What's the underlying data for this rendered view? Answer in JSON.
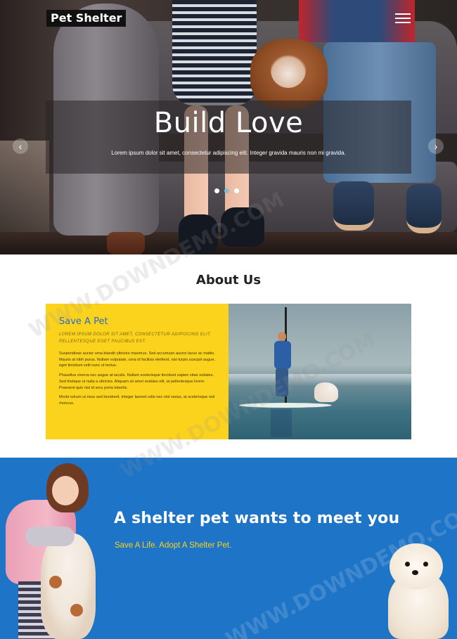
{
  "header": {
    "logo_text": "Pet Shelter",
    "menu_icon": "hamburger-icon"
  },
  "hero": {
    "title": "Build Love",
    "subtitle": "Lorem ipsum dolor sit amet, consectetur adipiscing elit. Integer gravida mauris non mi gravida.",
    "prev_arrow": "‹",
    "next_arrow": "›",
    "slides_count": 3,
    "active_slide": 2
  },
  "about": {
    "heading": "About Us",
    "card_title": "Save A Pet",
    "tagline": "Lorem ipsum dolor sit amet, consectetur adipiscing elit. Pellentesque eget faucibus est.",
    "paragraphs": [
      "Suspendisse auctor urna blandit ultricies maximus. Sed accumsan auctor lacus ac mattis. Mauris at nibh purus. Nullam vulputate, urna id facilisis eleifend, nisi turpis suscipit augue, eget tincidunt velit nunc ut lectus.",
      "Phasellus viverra nec augue at iaculis. Nullam scelerisque tincidunt sapien vitae sodales. Sed tristique ut nulla a ultricies. Aliquam sit amet sodales elit, at pellentesque lorem. Praesent quis nisl id arcu porta lobortis.",
      "Morbi rutrum ut risus sed hendrerit. Integer laoreet odio nec nisl varius, at scelerisque nisl rhoncus."
    ]
  },
  "banner": {
    "title": "A shelter pet wants to meet you",
    "subtitle": "Save A Life. Adopt A Shelter Pet."
  },
  "colors": {
    "accent_yellow": "#fcd31c",
    "banner_blue": "#1e74c6",
    "title_blue": "#2a6cc0",
    "active_dot": "#7fc0d8"
  },
  "watermark": "WWW.DOWNDEMO.COM"
}
